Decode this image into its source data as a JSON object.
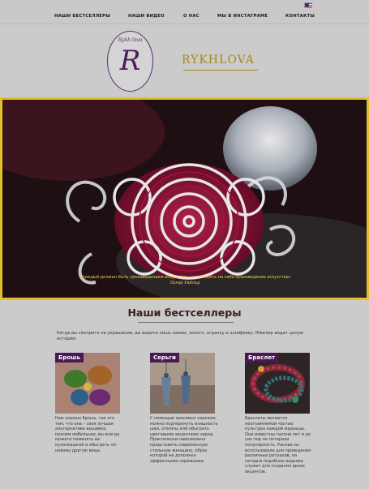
{
  "nav": {
    "items": [
      "НАШИ БЕСТСЕЛЛЕРЫ",
      "НАШИ ВИДЕО",
      "О НАС",
      "МЫ В ИНСТАГРАМЕ",
      "КОНТАКТЫ"
    ]
  },
  "icons": {
    "flag": "us-flag-icon"
  },
  "logo": {
    "small_text": "Rykh lova",
    "letter": "R",
    "brand": "RYKHLOVA"
  },
  "colors": {
    "accent_purple": "#4a1854",
    "gold": "#a8891f",
    "hero_border": "#e1bf2c"
  },
  "hero": {
    "quote": "«Каждый должен быть произведением искусства — или носить на себе произведение искусства»",
    "author": "Оскар Уайльд"
  },
  "bestsellers": {
    "title": "Наши бестселлеры",
    "intro": "Когда вы смотрите на украшение, вы видите лишь камни, золото, огранку и шлифовку. Ювелир видит целую историю",
    "cards": [
      {
        "label": "Брошь",
        "text": "Нам хорошо брошь, так это тем, что она – своя лучшая альтернатива вышивка, причем мобильная, вы всегда можете поменять ее кулонкашкой и обыграть по-новому другую вещь."
      },
      {
        "label": "Серьги",
        "text": "С помощью красивых сережек можно подчеркнуть изящность шеи, отвлечь или обыграть цветовыми акцентами наряд. Практически невозможно представить современную стильную женщину, образ которой не дополнен эффектными серёжками."
      },
      {
        "label": "Браслет",
        "text": "Браслеты являются неотъемлемой частью культуры каждой мадницы. Они известны тысячи лет и до сих пор не потеряли популярность. Ранние их использовали для проведения различных ритуалов, но сегодня подобное изделие служит для создания ярких акцентов."
      }
    ]
  }
}
